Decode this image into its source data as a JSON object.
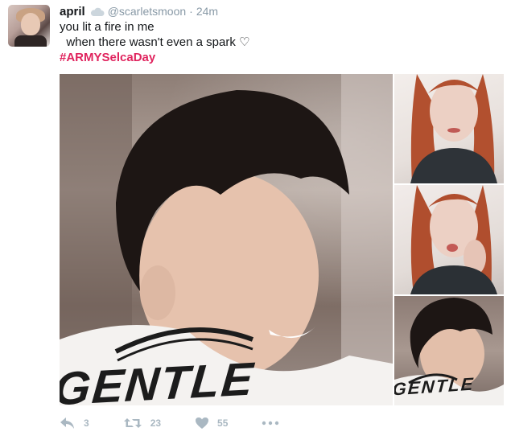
{
  "tweet": {
    "author": {
      "name": "april",
      "handle": "@scarletsmoon",
      "separator": "·",
      "time": "24m",
      "badge_icon": "cloud-icon"
    },
    "text_line_1": "you lit a fire in me",
    "text_line_2": "  when there wasn't even a spark ♡",
    "hashtag": "#ARMYSelcaDay",
    "photos": {
      "main_jacket_text": "GENTLE",
      "side_jacket_text": "GENTLE"
    },
    "actions": {
      "reply_count": "3",
      "retweet_count": "23",
      "like_count": "55",
      "more_icon": "more-dots-icon"
    },
    "colors": {
      "hashtag": "#e0245e",
      "muted": "#8899a6",
      "action_icon": "#aab8c2"
    }
  }
}
